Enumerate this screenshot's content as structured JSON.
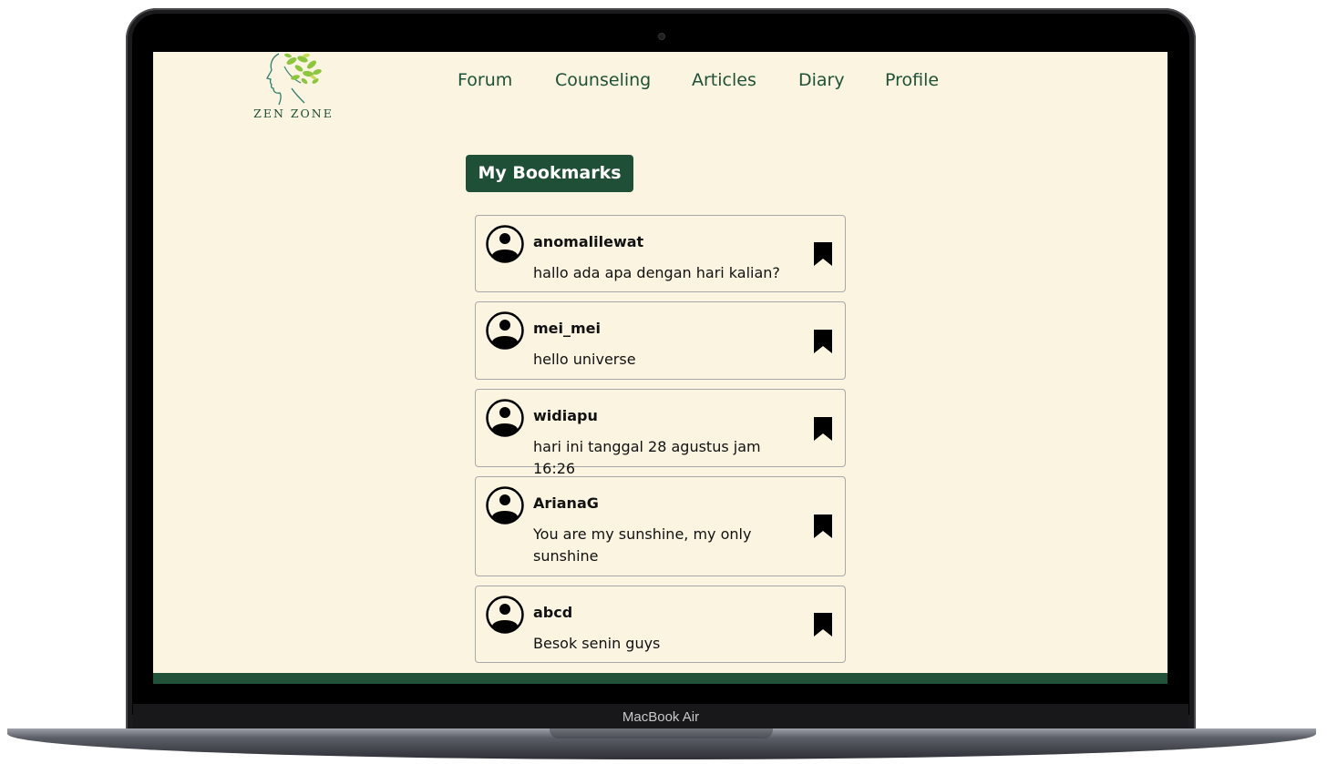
{
  "device": {
    "model_label": "MacBook Air"
  },
  "brand": {
    "logo_text": "ZEN ZONE"
  },
  "nav": [
    {
      "label": "Forum"
    },
    {
      "label": "Counseling"
    },
    {
      "label": "Articles"
    },
    {
      "label": "Diary"
    },
    {
      "label": "Profile"
    }
  ],
  "page": {
    "title": "My Bookmarks"
  },
  "bookmarks": [
    {
      "username": "anomalilewat",
      "message": "hallo ada apa dengan hari kalian?"
    },
    {
      "username": "mei_mei",
      "message": "hello universe"
    },
    {
      "username": "widiapu",
      "message": "hari ini tanggal 28 agustus jam 16:26"
    },
    {
      "username": "ArianaG",
      "message": "You are my sunshine, my only sunshine"
    },
    {
      "username": "abcd",
      "message": "Besok senin guys"
    }
  ],
  "colors": {
    "background": "#faf4e1",
    "accent": "#1f4f36",
    "nav_text": "#1f5136"
  }
}
